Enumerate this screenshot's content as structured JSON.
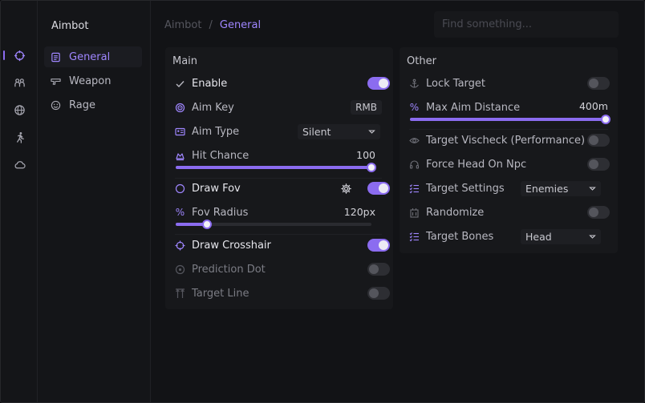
{
  "colors": {
    "accent": "#8b6cf0",
    "accent_text": "#9f86ff",
    "bg": "#121316",
    "panel": "#17181b"
  },
  "rail": {
    "items": [
      {
        "icon": "crosshair-icon"
      },
      {
        "icon": "users-icon"
      },
      {
        "icon": "globe-icon"
      },
      {
        "icon": "running-person-icon"
      },
      {
        "icon": "cloud-icon"
      }
    ]
  },
  "subbar": {
    "title": "Aimbot",
    "items": [
      {
        "label": "General",
        "icon": "document-icon",
        "active": true
      },
      {
        "label": "Weapon",
        "icon": "gun-icon",
        "active": false
      },
      {
        "label": "Rage",
        "icon": "smiley-icon",
        "active": false
      }
    ]
  },
  "breadcrumb": {
    "root": "Aimbot",
    "separator": "/",
    "current": "General"
  },
  "search": {
    "placeholder": "Find something..."
  },
  "main_panel": {
    "title": "Main",
    "enable_label": "Enable",
    "enable_on": true,
    "aim_key_label": "Aim Key",
    "aim_key_value": "RMB",
    "aim_type_label": "Aim Type",
    "aim_type_value": "Silent",
    "hit_chance_label": "Hit Chance",
    "hit_chance_value": "100",
    "hit_chance_fraction": 1.0,
    "draw_fov_label": "Draw Fov",
    "draw_fov_on": true,
    "fov_radius_icon": "%",
    "fov_radius_label": "Fov Radius",
    "fov_radius_value": "120px",
    "fov_radius_fraction": 0.16,
    "draw_crosshair_label": "Draw Crosshair",
    "draw_crosshair_on": true,
    "prediction_dot_label": "Prediction Dot",
    "prediction_dot_on": false,
    "target_line_label": "Target Line",
    "target_line_on": false
  },
  "other_panel": {
    "title": "Other",
    "lock_target_label": "Lock Target",
    "lock_target_on": false,
    "max_aim_icon": "%",
    "max_aim_label": "Max Aim Distance",
    "max_aim_value": "400m",
    "max_aim_fraction": 1.0,
    "vischeck_label": "Target Vischeck (Performance)",
    "vischeck_on": false,
    "force_head_label": "Force Head On Npc",
    "force_head_on": false,
    "target_settings_label": "Target Settings",
    "target_settings_value": "Enemies",
    "randomize_label": "Randomize",
    "randomize_on": false,
    "target_bones_label": "Target Bones",
    "target_bones_value": "Head"
  }
}
